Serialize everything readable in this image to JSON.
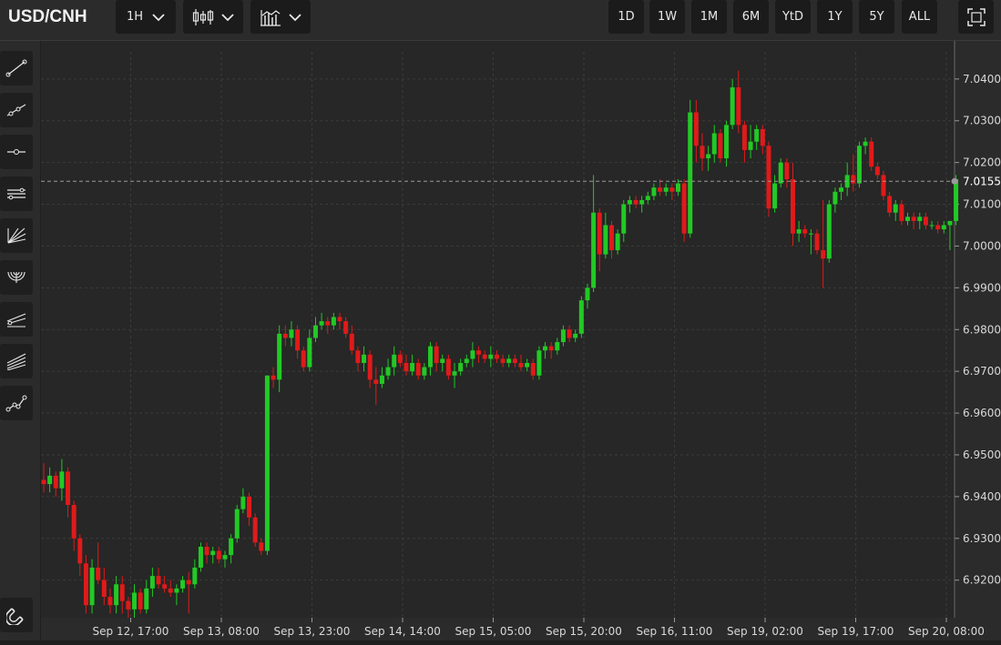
{
  "header": {
    "symbol": "USD/CNH",
    "interval": "1H",
    "ranges": [
      "1D",
      "1W",
      "1M",
      "6M",
      "YtD",
      "1Y",
      "5Y",
      "ALL"
    ]
  },
  "icons": {
    "interval_dropdown": "chevron-down-icon",
    "chart_type": "candlestick-icon",
    "indicators": "bar-chart-icon",
    "fullscreen": "fullscreen-icon"
  },
  "tools": [
    "trend-line-icon",
    "ray-line-icon",
    "horizontal-line-icon",
    "parallel-channel-icon",
    "fan-icon",
    "arc-icon",
    "regression-channel-icon",
    "pitchfork-icon",
    "polyline-icon"
  ],
  "bottom_tool": "magnet-icon",
  "colors": {
    "up": "#22c925",
    "down": "#e01a1a",
    "background": "#262726",
    "grid": "#3a3b3a"
  },
  "chart_data": {
    "type": "candlestick",
    "y_ticks": [
      "7.0400",
      "7.0300",
      "7.0200",
      "7.0100",
      "7.0000",
      "6.9900",
      "6.9800",
      "6.9700",
      "6.9600",
      "6.9500",
      "6.9400",
      "6.9300",
      "6.9200"
    ],
    "x_ticks": [
      "Sep 12, 17:00",
      "Sep 13, 08:00",
      "Sep 13, 23:00",
      "Sep 14, 14:00",
      "Sep 15, 05:00",
      "Sep 15, 20:00",
      "Sep 16, 11:00",
      "Sep 19, 02:00",
      "Sep 19, 17:00",
      "Sep 20, 08:00"
    ],
    "ylim": [
      6.911,
      7.0465
    ],
    "last_price": 7.0155,
    "last_price_label": "7.0155",
    "grid": true,
    "candles_ohlc": [
      [
        6.944,
        6.948,
        6.941,
        6.943
      ],
      [
        6.943,
        6.947,
        6.941,
        6.945
      ],
      [
        6.945,
        6.946,
        6.94,
        6.942
      ],
      [
        6.942,
        6.949,
        6.939,
        6.946
      ],
      [
        6.946,
        6.947,
        6.935,
        6.938
      ],
      [
        6.938,
        6.939,
        6.927,
        6.93
      ],
      [
        6.93,
        6.931,
        6.921,
        6.924
      ],
      [
        6.924,
        6.926,
        6.912,
        6.914
      ],
      [
        6.914,
        6.925,
        6.912,
        6.923
      ],
      [
        6.923,
        6.929,
        6.919,
        6.92
      ],
      [
        6.92,
        6.923,
        6.914,
        6.916
      ],
      [
        6.916,
        6.918,
        6.912,
        6.914
      ],
      [
        6.914,
        6.921,
        6.912,
        6.919
      ],
      [
        6.919,
        6.921,
        6.912,
        6.915
      ],
      [
        6.915,
        6.916,
        6.911,
        6.913
      ],
      [
        6.913,
        6.919,
        6.911,
        6.917
      ],
      [
        6.917,
        6.918,
        6.912,
        6.913
      ],
      [
        6.913,
        6.92,
        6.912,
        6.918
      ],
      [
        6.918,
        6.923,
        6.916,
        6.921
      ],
      [
        6.921,
        6.923,
        6.918,
        6.919
      ],
      [
        6.919,
        6.921,
        6.917,
        6.918
      ],
      [
        6.918,
        6.92,
        6.916,
        6.917
      ],
      [
        6.917,
        6.919,
        6.914,
        6.918
      ],
      [
        6.918,
        6.921,
        6.917,
        6.92
      ],
      [
        6.92,
        6.922,
        6.912,
        6.919
      ],
      [
        6.919,
        6.925,
        6.918,
        6.923
      ],
      [
        6.923,
        6.929,
        6.922,
        6.928
      ],
      [
        6.928,
        6.929,
        6.924,
        6.926
      ],
      [
        6.926,
        6.928,
        6.924,
        6.927
      ],
      [
        6.927,
        6.928,
        6.924,
        6.925
      ],
      [
        6.925,
        6.927,
        6.923,
        6.926
      ],
      [
        6.926,
        6.931,
        6.924,
        6.93
      ],
      [
        6.93,
        6.938,
        6.929,
        6.937
      ],
      [
        6.937,
        6.942,
        6.936,
        6.94
      ],
      [
        6.94,
        6.941,
        6.933,
        6.935
      ],
      [
        6.935,
        6.936,
        6.928,
        6.929
      ],
      [
        6.929,
        6.93,
        6.926,
        6.927
      ],
      [
        6.927,
        6.969,
        6.926,
        6.969
      ],
      [
        6.969,
        6.971,
        6.966,
        6.968
      ],
      [
        6.968,
        6.981,
        6.965,
        6.979
      ],
      [
        6.979,
        6.981,
        6.976,
        6.978
      ],
      [
        6.978,
        6.982,
        6.976,
        6.98
      ],
      [
        6.98,
        6.981,
        6.973,
        6.975
      ],
      [
        6.975,
        6.976,
        6.97,
        6.971
      ],
      [
        6.971,
        6.98,
        6.97,
        6.978
      ],
      [
        6.978,
        6.983,
        6.977,
        6.981
      ],
      [
        6.981,
        6.984,
        6.98,
        6.982
      ],
      [
        6.982,
        6.983,
        6.979,
        6.981
      ],
      [
        6.981,
        6.984,
        6.98,
        6.983
      ],
      [
        6.983,
        6.984,
        6.98,
        6.982
      ],
      [
        6.982,
        6.983,
        6.978,
        6.979
      ],
      [
        6.979,
        6.981,
        6.974,
        6.975
      ],
      [
        6.975,
        6.976,
        6.97,
        6.972
      ],
      [
        6.972,
        6.976,
        6.97,
        6.974
      ],
      [
        6.974,
        6.975,
        6.966,
        6.968
      ],
      [
        6.968,
        6.971,
        6.962,
        6.967
      ],
      [
        6.967,
        6.971,
        6.966,
        6.969
      ],
      [
        6.969,
        6.973,
        6.968,
        6.971
      ],
      [
        6.971,
        6.976,
        6.969,
        6.974
      ],
      [
        6.974,
        6.975,
        6.971,
        6.972
      ],
      [
        6.972,
        6.974,
        6.969,
        6.97
      ],
      [
        6.97,
        6.974,
        6.969,
        6.972
      ],
      [
        6.972,
        6.973,
        6.968,
        6.969
      ],
      [
        6.969,
        6.972,
        6.968,
        6.971
      ],
      [
        6.971,
        6.977,
        6.969,
        6.976
      ],
      [
        6.976,
        6.977,
        6.97,
        6.972
      ],
      [
        6.972,
        6.974,
        6.97,
        6.973
      ],
      [
        6.973,
        6.974,
        6.968,
        6.969
      ],
      [
        6.969,
        6.972,
        6.966,
        6.97
      ],
      [
        6.97,
        6.973,
        6.969,
        6.972
      ],
      [
        6.972,
        6.974,
        6.971,
        6.973
      ],
      [
        6.973,
        6.977,
        6.971,
        6.975
      ],
      [
        6.975,
        6.976,
        6.972,
        6.974
      ],
      [
        6.974,
        6.975,
        6.972,
        6.973
      ],
      [
        6.973,
        6.976,
        6.971,
        6.974
      ],
      [
        6.974,
        6.975,
        6.972,
        6.973
      ],
      [
        6.973,
        6.974,
        6.971,
        6.972
      ],
      [
        6.972,
        6.974,
        6.971,
        6.973
      ],
      [
        6.973,
        6.974,
        6.971,
        6.972
      ],
      [
        6.972,
        6.974,
        6.97,
        6.971
      ],
      [
        6.971,
        6.973,
        6.97,
        6.972
      ],
      [
        6.972,
        6.973,
        6.968,
        6.969
      ],
      [
        6.969,
        6.976,
        6.968,
        6.975
      ],
      [
        6.975,
        6.977,
        6.973,
        6.976
      ],
      [
        6.976,
        6.977,
        6.973,
        6.975
      ],
      [
        6.975,
        6.978,
        6.974,
        6.977
      ],
      [
        6.977,
        6.981,
        6.976,
        6.98
      ],
      [
        6.98,
        6.981,
        6.977,
        6.978
      ],
      [
        6.978,
        6.98,
        6.977,
        6.979
      ],
      [
        6.979,
        6.988,
        6.978,
        6.987
      ],
      [
        6.987,
        6.991,
        6.985,
        6.99
      ],
      [
        6.99,
        7.017,
        6.989,
        7.008
      ],
      [
        7.008,
        7.009,
        6.994,
        6.998
      ],
      [
        6.998,
        7.008,
        6.997,
        7.005
      ],
      [
        7.005,
        7.006,
        6.997,
        6.999
      ],
      [
        6.999,
        7.004,
        6.998,
        7.003
      ],
      [
        7.003,
        7.011,
        7.001,
        7.01
      ],
      [
        7.01,
        7.012,
        7.008,
        7.011
      ],
      [
        7.011,
        7.012,
        7.009,
        7.01
      ],
      [
        7.01,
        7.012,
        7.008,
        7.011
      ],
      [
        7.011,
        7.013,
        7.01,
        7.012
      ],
      [
        7.012,
        7.015,
        7.011,
        7.014
      ],
      [
        7.014,
        7.016,
        7.012,
        7.013
      ],
      [
        7.013,
        7.015,
        7.012,
        7.014
      ],
      [
        7.014,
        7.015,
        7.011,
        7.013
      ],
      [
        7.013,
        7.016,
        7.012,
        7.015
      ],
      [
        7.015,
        7.016,
        7.001,
        7.003
      ],
      [
        7.003,
        7.035,
        7.002,
        7.032
      ],
      [
        7.032,
        7.035,
        7.02,
        7.024
      ],
      [
        7.024,
        7.027,
        7.018,
        7.021
      ],
      [
        7.021,
        7.024,
        7.018,
        7.022
      ],
      [
        7.022,
        7.029,
        7.02,
        7.027
      ],
      [
        7.027,
        7.028,
        7.02,
        7.021
      ],
      [
        7.021,
        7.03,
        7.019,
        7.029
      ],
      [
        7.029,
        7.04,
        7.028,
        7.038
      ],
      [
        7.038,
        7.042,
        7.027,
        7.029
      ],
      [
        7.029,
        7.03,
        7.02,
        7.023
      ],
      [
        7.023,
        7.029,
        7.021,
        7.025
      ],
      [
        7.025,
        7.029,
        7.023,
        7.028
      ],
      [
        7.028,
        7.029,
        7.022,
        7.024
      ],
      [
        7.024,
        7.025,
        7.007,
        7.009
      ],
      [
        7.009,
        7.017,
        7.008,
        7.015
      ],
      [
        7.015,
        7.021,
        7.014,
        7.02
      ],
      [
        7.02,
        7.021,
        7.014,
        7.016
      ],
      [
        7.016,
        7.02,
        7.0,
        7.003
      ],
      [
        7.003,
        7.006,
        7.001,
        7.004
      ],
      [
        7.004,
        7.005,
        7.002,
        7.003
      ],
      [
        7.003,
        7.004,
        6.998,
        7.003
      ],
      [
        7.003,
        7.004,
        6.998,
        6.999
      ],
      [
        6.999,
        7.011,
        6.99,
        6.997
      ],
      [
        6.997,
        7.011,
        6.996,
        7.01
      ],
      [
        7.01,
        7.014,
        7.008,
        7.013
      ],
      [
        7.013,
        7.015,
        7.011,
        7.014
      ],
      [
        7.014,
        7.02,
        7.012,
        7.017
      ],
      [
        7.017,
        7.022,
        7.013,
        7.015
      ],
      [
        7.015,
        7.025,
        7.014,
        7.024
      ],
      [
        7.024,
        7.026,
        7.022,
        7.025
      ],
      [
        7.025,
        7.026,
        7.018,
        7.019
      ],
      [
        7.019,
        7.02,
        7.016,
        7.017
      ],
      [
        7.017,
        7.018,
        7.011,
        7.012
      ],
      [
        7.012,
        7.013,
        7.007,
        7.008
      ],
      [
        7.008,
        7.011,
        7.006,
        7.01
      ],
      [
        7.01,
        7.011,
        7.005,
        7.006
      ],
      [
        7.006,
        7.008,
        7.005,
        7.007
      ],
      [
        7.007,
        7.008,
        7.004,
        7.006
      ],
      [
        7.006,
        7.008,
        7.004,
        7.007
      ],
      [
        7.007,
        7.008,
        7.004,
        7.005
      ],
      [
        7.005,
        7.006,
        7.004,
        7.005
      ],
      [
        7.005,
        7.006,
        7.003,
        7.004
      ],
      [
        7.004,
        7.006,
        7.003,
        7.005
      ],
      [
        7.005,
        7.006,
        6.999,
        7.006
      ],
      [
        7.006,
        7.017,
        7.005,
        7.016
      ]
    ]
  }
}
